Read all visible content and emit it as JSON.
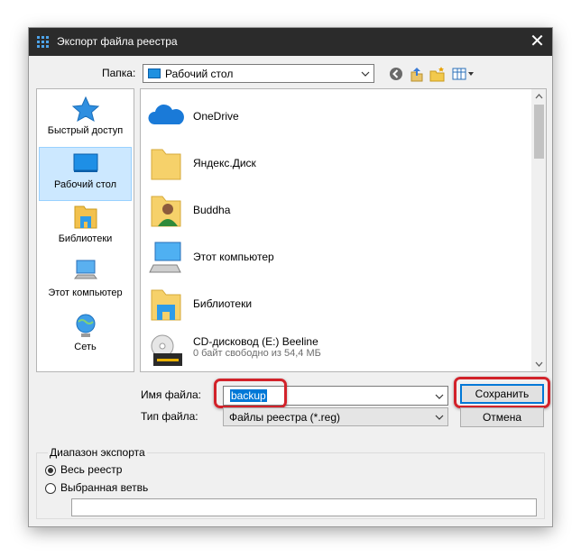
{
  "window": {
    "title": "Экспорт файла реестра",
    "close_glyph": "✕"
  },
  "location": {
    "label": "Папка:",
    "current": "Рабочий стол"
  },
  "places": [
    {
      "label": "Быстрый доступ",
      "icon": "star-icon"
    },
    {
      "label": "Рабочий стол",
      "icon": "desktop-icon",
      "selected": true
    },
    {
      "label": "Библиотеки",
      "icon": "libraries-icon"
    },
    {
      "label": "Этот компьютер",
      "icon": "computer-icon"
    },
    {
      "label": "Сеть",
      "icon": "network-icon"
    }
  ],
  "files": [
    {
      "name": "OneDrive",
      "icon": "onedrive-cloud-icon"
    },
    {
      "name": "Яндекс.Диск",
      "icon": "folder-icon"
    },
    {
      "name": "Buddha",
      "icon": "user-folder-icon"
    },
    {
      "name": "Этот компьютер",
      "icon": "computer-icon"
    },
    {
      "name": "Библиотеки",
      "icon": "libraries-folder-icon"
    },
    {
      "name": "CD-дисковод (E:) Beeline",
      "detail": "0 байт свободно из 54,4 МБ",
      "icon": "cd-drive-icon",
      "progress": 1.0
    }
  ],
  "form": {
    "filename_label": "Имя файла:",
    "filename_value": "backup",
    "filetype_label": "Тип файла:",
    "filetype_value": "Файлы реестра (*.reg)",
    "save_label": "Сохранить",
    "cancel_label": "Отмена"
  },
  "export_range": {
    "title": "Диапазон экспорта",
    "all_label": "Весь реестр",
    "branch_label": "Выбранная ветвь",
    "branch_value": "",
    "selected": "all"
  },
  "colors": {
    "titlebar": "#2b2b2b",
    "accent": "#0078d7",
    "highlight": "#d2222a",
    "selection": "#cce8ff"
  }
}
